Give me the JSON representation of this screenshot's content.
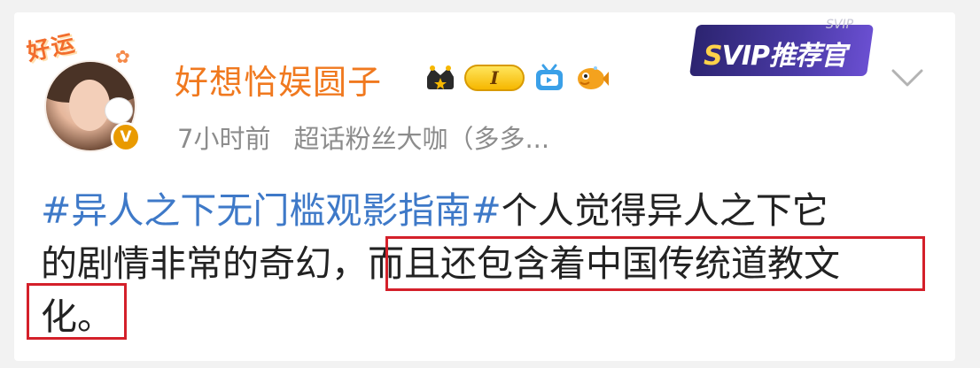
{
  "user": {
    "name": "好想恰娱圆子",
    "sticker_text": "好运",
    "avatar_badge": "V",
    "level_badge": "I",
    "time": "7小时前",
    "source": "超话粉丝大咖（多多..."
  },
  "svip": {
    "label_s": "S",
    "label_rest": "VIP推荐官",
    "ghost_text": "SVIP"
  },
  "post": {
    "tag": "#异人之下无门槛观影指南#",
    "line1_rest": "个人觉得异人之下它",
    "line2_plain": "的剧情非常的奇幻，",
    "line2_highlight": "而且还包含着中国传统道教文",
    "line3": "化。"
  },
  "colors": {
    "username": "#f0791f",
    "tag": "#3e79c8",
    "meta": "#8c8c8c",
    "highlight_border": "#d4202a"
  },
  "icons": [
    "crown-icon",
    "level-badge",
    "tv-icon",
    "fish-icon",
    "chevron-down-icon"
  ]
}
